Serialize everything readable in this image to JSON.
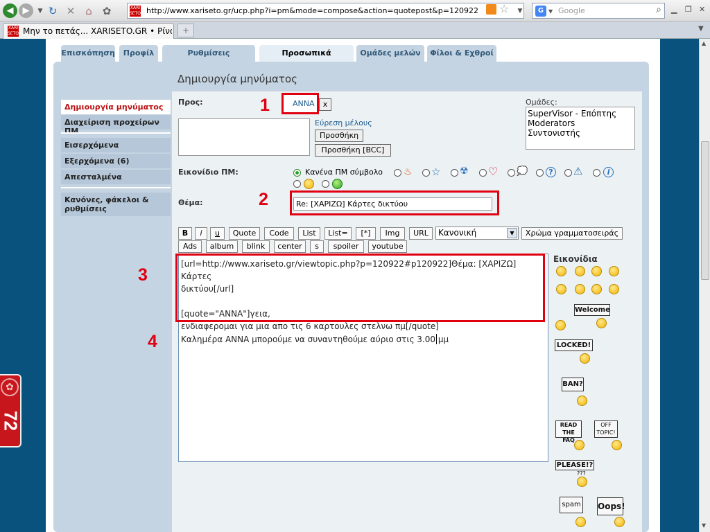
{
  "browser": {
    "url": "http://www.xariseto.gr/ucp.php?i=pm&mode=compose&action=quotepost&p=120922",
    "search_placeholder": "Google",
    "tab_title": "Μην το πετάς... XARISETO.GR • Pίνα...",
    "favicon_text": "XARI SETO",
    "new_tab_label": "+"
  },
  "nav_tabs": [
    "Επισκόπηση",
    "Προφίλ",
    "Ρυθμίσεις κοινότητας",
    "Προσωπικά μηνύματα",
    "Ομάδες μελών",
    "Φίλοι & Εχθροί"
  ],
  "page_title": "Δημιουργία μηνύματος",
  "sidebar": {
    "group1": [
      "Δημιουργία μηνύματος",
      "Διαχείριση προχείρων ΠΜ"
    ],
    "group2": [
      "Εισερχόμενα",
      "Εξερχόμενα (6)",
      "Απεσταλμένα"
    ],
    "group3": "Κανόνες, φάκελοι & ρυθμίσεις"
  },
  "to": {
    "label": "Προς:",
    "recipient": "ANNA",
    "remove": "x",
    "find_member": "Εύρεση μέλους",
    "add": "Προσθήκη",
    "add_bcc": "Προσθήκη [BCC]"
  },
  "groups": {
    "label": "Ομάδες:",
    "options": [
      "SuperVisor - Επόπτης",
      "Moderators",
      "Συντονιστής"
    ]
  },
  "icon": {
    "label": "Εικονίδιο ΠΜ:",
    "none_label": "Κανένα ΠΜ σύμβολο",
    "icons": [
      "fire-icon",
      "star-icon",
      "radiation-icon",
      "heart-icon",
      "speech-bubble-icon",
      "question-icon",
      "warning-icon",
      "info-icon",
      "smile-icon",
      "grin-icon"
    ]
  },
  "subject": {
    "label": "Θέμα:",
    "value": "Re: [ΧΑΡΙΖΩ] Κάρτες δικτύου"
  },
  "toolbar": {
    "row1": [
      "B",
      "i",
      "u",
      "Quote",
      "Code",
      "List",
      "List=",
      "[*]",
      "Img",
      "URL"
    ],
    "font_size": "Κανονική",
    "font_color": "Χρώμα γραμματοσειράς",
    "row2": [
      "Ads",
      "album",
      "blink",
      "center",
      "s",
      "spoiler",
      "youtube"
    ]
  },
  "message": {
    "line1": "[url=http://www.xariseto.gr/viewtopic.php?p=120922#p120922]Θέμα: [ΧΑΡΙΖΩ] Κάρτες",
    "line2": "δικτύου[/url]",
    "line3": "[quote=\"ANNA\"]γεια,",
    "line4": "ενδιαφερομαι για μια απο τις 6 καρτουλες στελνω πμ[/quote]",
    "reply": "Καλημέρα ANNA μπορούμε να συναντηθούμε αύριο στις 3.00 μμ"
  },
  "smilies": {
    "title": "Εικονίδια",
    "signs": [
      "Welcome",
      "LOCKED!",
      "BAN?",
      "READ THE FAQ",
      "OFF TOPIC!",
      "PLEASE!?",
      "???",
      "spam",
      "Oops!"
    ]
  },
  "annotations": [
    "1",
    "2",
    "3",
    "4"
  ],
  "badge": "72",
  "colors": {
    "accent_red": "#e00010",
    "page_bg": "#0a527e",
    "panel": "#c5d4e2",
    "link": "#1b5a8f"
  }
}
